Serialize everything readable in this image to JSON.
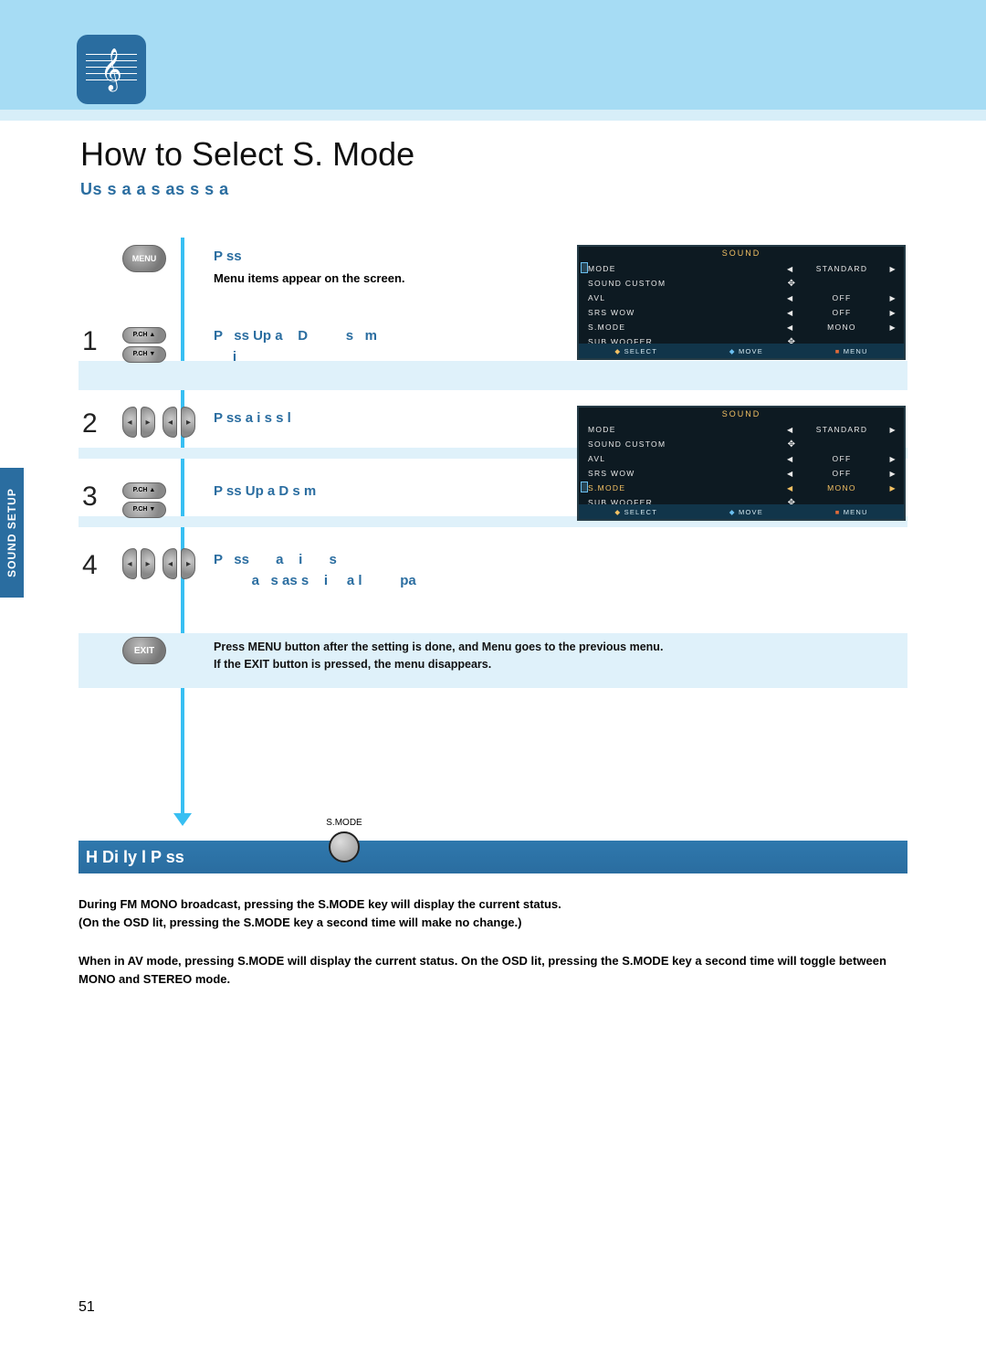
{
  "page": {
    "number": "51",
    "title": "How to Select S. Mode",
    "subhead": "Us  s  a  a   s        as s  s  a"
  },
  "sidebar": {
    "label": "SOUND SETUP"
  },
  "buttons": {
    "menu": "MENU",
    "exit": "EXIT",
    "pch_up": "P.CH ▲",
    "pch_down": "P.CH ▼"
  },
  "steps": {
    "intro": {
      "label": "P   ss",
      "sub": "Menu items appear on the screen."
    },
    "s1": {
      "num": "1",
      "text": "P   ss Up a    D          s   m\n     i"
    },
    "s2": {
      "num": "2",
      "text": "P   ss       a    i       s    s l"
    },
    "s3": {
      "num": "3",
      "text": "P   ss Up a    D          s   m"
    },
    "s4": {
      "num": "4",
      "text": "P   ss       a    i       s\n          a   s as s    i     a l          pa"
    }
  },
  "exit_note": {
    "line1": "Press MENU button after the setting is done, and Menu goes to the previous menu.",
    "line2": "If the EXIT button is pressed, the menu disappears."
  },
  "osd1": {
    "title": "SOUND",
    "rows": [
      {
        "label": "MODE",
        "value": "STANDARD",
        "arrows": true,
        "selected": true,
        "hl": false
      },
      {
        "label": "SOUND  CUSTOM",
        "center": "✥",
        "arrows": false
      },
      {
        "label": "AVL",
        "value": "OFF",
        "arrows": true
      },
      {
        "label": "SRS  WOW",
        "value": "OFF",
        "arrows": true
      },
      {
        "label": "S.MODE",
        "value": "MONO",
        "arrows": true
      },
      {
        "label": "SUB  WOOFER",
        "center": "✥",
        "arrows": false
      }
    ],
    "footer": {
      "a": "SELECT",
      "b": "MOVE",
      "c": "MENU"
    }
  },
  "osd2": {
    "title": "SOUND",
    "rows": [
      {
        "label": "MODE",
        "value": "STANDARD",
        "arrows": true
      },
      {
        "label": "SOUND  CUSTOM",
        "center": "✥",
        "arrows": false
      },
      {
        "label": "AVL",
        "value": "OFF",
        "arrows": true
      },
      {
        "label": "SRS  WOW",
        "value": "OFF",
        "arrows": true
      },
      {
        "label": "S.MODE",
        "value": "MONO",
        "arrows": true,
        "hl": true,
        "selected": true
      },
      {
        "label": "SUB  WOOFER",
        "center": "✥",
        "arrows": false
      }
    ],
    "footer": {
      "a": "SELECT",
      "b": "MOVE",
      "c": "MENU"
    }
  },
  "direct": {
    "title": "H     Di   ly  l         P   ss",
    "smode_label": "S.MODE",
    "para1a": "During FM MONO broadcast, pressing the S.MODE key will display the current status.",
    "para1b": "(On the OSD lit, pressing the S.MODE key a second time will make no change.)",
    "para2": "When in AV mode, pressing S.MODE will display the current status. On the OSD lit, pressing the S.MODE key a second time will toggle between MONO and STEREO mode."
  }
}
